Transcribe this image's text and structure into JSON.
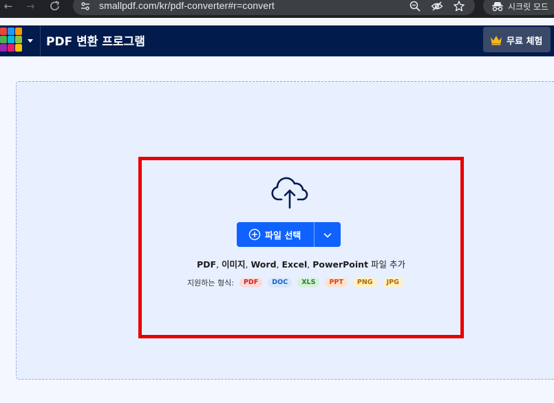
{
  "browser": {
    "url": "smallpdf.com/kr/pdf-converter#r=convert",
    "incognito_label": "시크릿 모드",
    "icons": [
      "back-arrow-icon",
      "forward-arrow-icon",
      "reload-icon",
      "site-info-icon",
      "zoom-icon",
      "eye-off-icon",
      "star-icon",
      "incognito-icon"
    ]
  },
  "header": {
    "title": "PDF 변환 프로그램",
    "trial_label": "무료 체험",
    "switcher_colors": [
      "#e8453c",
      "#2196f3",
      "#ff9800",
      "#4caf50",
      "#00bcd4",
      "#8bc34a",
      "#9c27b0",
      "#e91e63",
      "#ffc107"
    ]
  },
  "upload": {
    "choose_label": "파일 선택",
    "types": {
      "list": [
        {
          "name": "PDF",
          "sep": ", "
        },
        {
          "name": "이미지",
          "sep": ", "
        },
        {
          "name": "Word",
          "sep": ", "
        },
        {
          "name": "Excel",
          "sep": ", "
        },
        {
          "name": "PowerPoint",
          "sep": " "
        }
      ],
      "suffix": "파일 추가"
    },
    "supported_label": "지원하는 형식:",
    "formats": [
      {
        "label": "PDF",
        "bg": "#fcd9d9",
        "fg": "#c62828"
      },
      {
        "label": "DOC",
        "bg": "#d6e6fb",
        "fg": "#1565c0"
      },
      {
        "label": "XLS",
        "bg": "#d4f1d9",
        "fg": "#2e7d32"
      },
      {
        "label": "PPT",
        "bg": "#fde2cf",
        "fg": "#d84315"
      },
      {
        "label": "PNG",
        "bg": "#fdf1c6",
        "fg": "#b26a00"
      },
      {
        "label": "JPG",
        "bg": "#fdf1c6",
        "fg": "#b26a00"
      }
    ]
  },
  "colors": {
    "accent": "#0f62fe",
    "header_bg": "#021b4d",
    "highlight": "#e60000"
  }
}
